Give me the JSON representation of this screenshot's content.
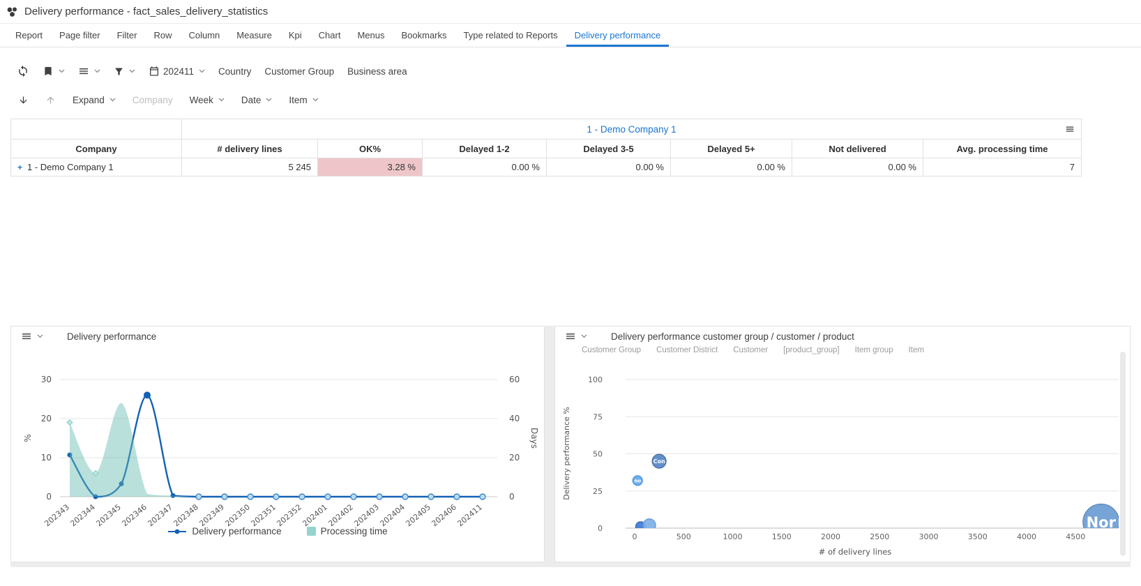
{
  "titlebar": {
    "title": "Delivery performance - fact_sales_delivery_statistics"
  },
  "nav": {
    "tabs": [
      {
        "label": "Report"
      },
      {
        "label": "Page filter"
      },
      {
        "label": "Filter"
      },
      {
        "label": "Row"
      },
      {
        "label": "Column"
      },
      {
        "label": "Measure"
      },
      {
        "label": "Kpi"
      },
      {
        "label": "Chart"
      },
      {
        "label": "Menus"
      },
      {
        "label": "Bookmarks"
      },
      {
        "label": "Type related to Reports"
      },
      {
        "label": "Delivery performance",
        "active": true
      }
    ]
  },
  "toolbar": {
    "period_value": "202411",
    "filter_buttons": [
      {
        "label": "Country"
      },
      {
        "label": "Customer Group"
      },
      {
        "label": "Business area"
      }
    ],
    "row2": {
      "expand_label": "Expand",
      "company_label": "Company",
      "week_label": "Week",
      "date_label": "Date",
      "item_label": "Item"
    }
  },
  "table": {
    "group_header": "1 - Demo Company 1",
    "columns": [
      "Company",
      "# delivery lines",
      "OK%",
      "Delayed 1-2",
      "Delayed 3-5",
      "Delayed 5+",
      "Not delivered",
      "Avg. processing time"
    ],
    "rows": [
      {
        "expand_glyph": "+",
        "company": "1 - Demo Company 1",
        "values": [
          "5 245",
          "3.28 %",
          "0.00 %",
          "0.00 %",
          "0.00 %",
          "0.00 %",
          "7"
        ]
      }
    ],
    "ok_highlight_color": "#eec6c9"
  },
  "panels": {
    "left": {
      "title": "Delivery performance",
      "legend": [
        {
          "label": "Delivery performance",
          "color": "#1361b5"
        },
        {
          "label": "Processing time",
          "color": "#93d5ce"
        }
      ]
    },
    "right": {
      "title": "Delivery performance customer group / customer / product",
      "tabs": [
        "Customer Group",
        "Customer District",
        "Customer",
        "[product_group]",
        "Item group",
        "Item"
      ]
    }
  },
  "chart_data": [
    {
      "type": "line",
      "title": "Delivery performance",
      "categories": [
        "202343",
        "202344",
        "202345",
        "202346",
        "202347",
        "202348",
        "202349",
        "202350",
        "202351",
        "202352",
        "202401",
        "202402",
        "202403",
        "202404",
        "202405",
        "202406",
        "202411"
      ],
      "series": [
        {
          "name": "Delivery performance",
          "render": "line",
          "axis": "left",
          "unit": "%",
          "color": "#1361b5",
          "values": [
            10.7,
            0,
            3.3,
            26,
            0.3,
            0,
            0,
            0,
            0,
            0,
            0,
            0,
            0,
            0,
            0,
            0,
            0
          ]
        },
        {
          "name": "Processing time",
          "render": "area",
          "axis": "right",
          "unit": "Days",
          "color": "#66bbb2",
          "values": [
            38,
            12,
            48,
            1.5,
            0.5,
            0,
            0,
            0,
            0,
            0,
            0,
            0,
            0,
            0,
            0,
            0,
            0
          ]
        }
      ],
      "left_axis": {
        "label": "%",
        "ticks": [
          0,
          10,
          20,
          30
        ],
        "max": 30
      },
      "right_axis": {
        "label": "Days",
        "ticks": [
          0,
          20,
          40,
          60
        ],
        "max": 60
      },
      "legend_position": "bottom"
    },
    {
      "type": "scatter",
      "title": "Delivery performance customer group / customer / product",
      "xlabel": "# of delivery lines",
      "ylabel": "Delivery performance %",
      "x_ticks": [
        0,
        500,
        1000,
        1500,
        2000,
        2500,
        3000,
        3500,
        4000,
        4500
      ],
      "y_ticks": [
        0,
        25,
        50,
        75,
        100
      ],
      "xlim": [
        0,
        4950
      ],
      "ylim": [
        0,
        100
      ],
      "points": [
        {
          "x": 30,
          "y": 32,
          "r": 7,
          "label": "no",
          "color": "#63a9ee",
          "border": "#4a90d8"
        },
        {
          "x": 250,
          "y": 45,
          "r": 10,
          "label": "Con",
          "color": "#5585c5",
          "border": "#46709f"
        },
        {
          "x": 60,
          "y": 1,
          "r": 7,
          "label": "",
          "color": "#3f7ad2",
          "border": "#3567b5"
        },
        {
          "x": 150,
          "y": 2,
          "r": 9,
          "label": "",
          "color": "#7fb0e6",
          "border": "#5d96d6"
        },
        {
          "x": 4760,
          "y": 4,
          "r": 26,
          "label": "Nor",
          "color": "#6b9cd4",
          "border": "#5a87bd"
        }
      ]
    }
  ]
}
